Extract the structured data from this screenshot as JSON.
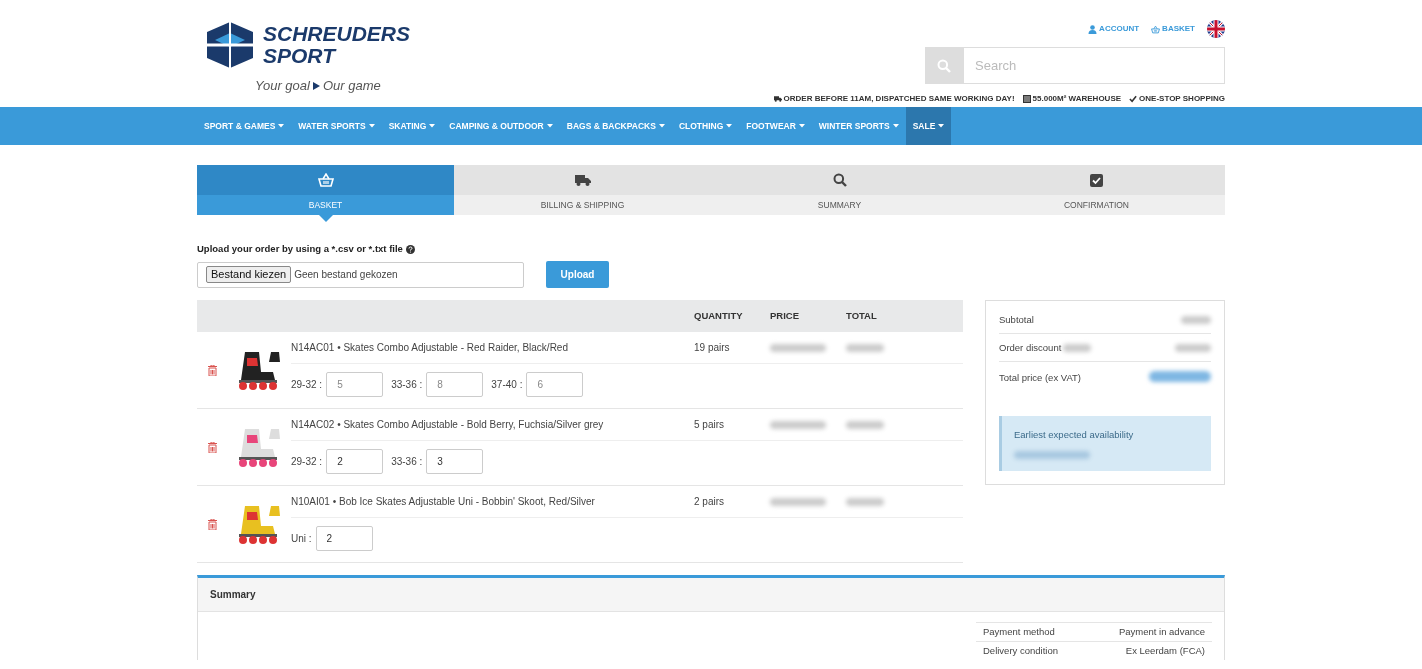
{
  "header": {
    "logo": {
      "line_1": "SCHREUDERS",
      "line_2": "SPORT",
      "tagline_1": "Your goal",
      "tagline_2": "Our game"
    },
    "links": [
      "ACCOUNT",
      "BASKET"
    ],
    "search": {
      "placeholder": "Search"
    },
    "usps": [
      "ORDER BEFORE 11AM, DISPATCHED SAME WORKING DAY!",
      "55.000M² WAREHOUSE",
      "ONE-STOP SHOPPING"
    ]
  },
  "nav": [
    {
      "label": "SPORT & GAMES",
      "selected": false
    },
    {
      "label": "WATER SPORTS",
      "selected": false
    },
    {
      "label": "SKATING",
      "selected": false
    },
    {
      "label": "CAMPING & OUTDOOR",
      "selected": false
    },
    {
      "label": "BAGS & BACKPACKS",
      "selected": false
    },
    {
      "label": "CLOTHING",
      "selected": false
    },
    {
      "label": "FOOTWEAR",
      "selected": false
    },
    {
      "label": "WINTER SPORTS",
      "selected": false
    },
    {
      "label": "SALE",
      "selected": true
    }
  ],
  "steps": [
    {
      "label": "BASKET",
      "selected": true
    },
    {
      "label": "BILLING & SHIPPING",
      "selected": false
    },
    {
      "label": "SUMMARY",
      "selected": false
    },
    {
      "label": "CONFIRMATION",
      "selected": false
    }
  ],
  "upload": {
    "label": "Upload your order by using a *.csv or *.txt file",
    "choose_button": "Bestand kiezen",
    "file_status": "Geen bestand gekozen",
    "upload_button": "Upload"
  },
  "table": {
    "columns": [
      "QUANTITY",
      "PRICE",
      "TOTAL"
    ],
    "rows": [
      {
        "title": "N14AC01 • Skates Combo Adjustable - Red Raider, Black/Red",
        "quantity": "19 pairs",
        "sizes": [
          {
            "label": "29-32 :",
            "placeholder": "5"
          },
          {
            "label": "33-36 :",
            "placeholder": "8"
          },
          {
            "label": "37-40 :",
            "placeholder": "6"
          }
        ]
      },
      {
        "title": "N14AC02 • Skates Combo Adjustable - Bold Berry, Fuchsia/Silver grey",
        "quantity": "5 pairs",
        "sizes": [
          {
            "label": "29-32 :",
            "value": "2"
          },
          {
            "label": "33-36 :",
            "value": "3"
          }
        ]
      },
      {
        "title": "N10AI01 • Bob Ice Skates Adjustable Uni - Bobbin' Skoot, Red/Silver",
        "quantity": "2 pairs",
        "sizes": [
          {
            "label": "Uni :",
            "value": "2"
          }
        ]
      }
    ]
  },
  "totals": {
    "rows": [
      {
        "label": "Subtotal",
        "kind": "plain"
      },
      {
        "label": "Order discount",
        "kind": "discount"
      },
      {
        "label": "Total price (ex VAT)",
        "kind": "total"
      }
    ],
    "availability_label": "Earliest expected availability"
  },
  "summary": {
    "title": "Summary",
    "rows": [
      {
        "label": "Payment method",
        "value": "Payment in advance"
      },
      {
        "label": "Delivery condition",
        "value": "Ex Leerdam (FCA)"
      }
    ]
  }
}
